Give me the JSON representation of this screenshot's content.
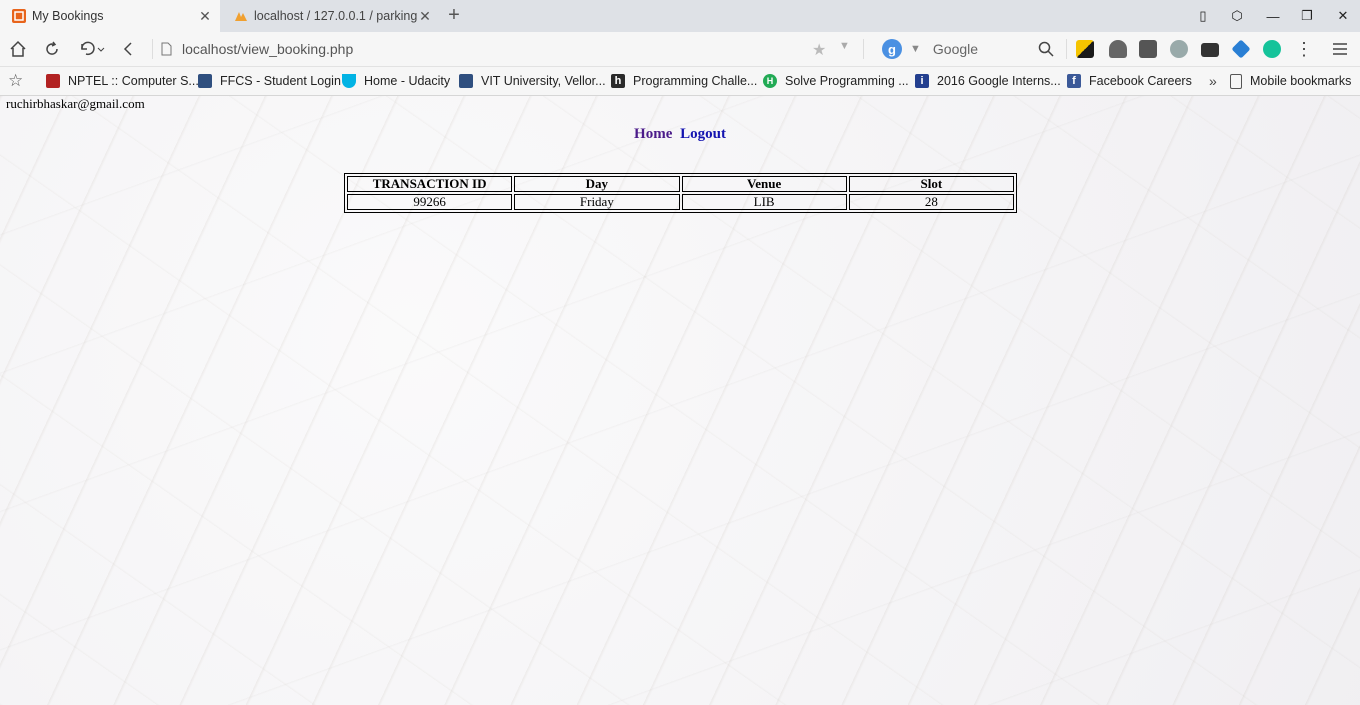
{
  "browser": {
    "tabs": [
      {
        "title": "My Bookings",
        "active": true,
        "favicon": "page-icon"
      },
      {
        "title": "localhost / 127.0.0.1 / parking",
        "active": false,
        "favicon": "phpmyadmin-icon"
      }
    ],
    "address": {
      "url": "localhost/view_booking.php"
    },
    "search": {
      "engine": "Google"
    },
    "bookmarks": [
      {
        "label": "NPTEL :: Computer S...",
        "icon": "nptel-icon",
        "color": "#b22222"
      },
      {
        "label": "FFCS - Student Login",
        "icon": "vit-icon",
        "color": "#2f4f7f"
      },
      {
        "label": "Home - Udacity",
        "icon": "udacity-icon",
        "color": "#02b3e4"
      },
      {
        "label": "VIT University, Vellor...",
        "icon": "vit-icon",
        "color": "#2f4f7f"
      },
      {
        "label": "Programming Challe...",
        "icon": "hackerrank-icon",
        "color": "#2a2a2a"
      },
      {
        "label": "Solve Programming ...",
        "icon": "hackerearth-icon",
        "color": "#22aa55"
      },
      {
        "label": "2016 Google Interns...",
        "icon": "info-icon",
        "color": "#233f8f"
      },
      {
        "label": "Facebook Careers",
        "icon": "facebook-icon",
        "color": "#3b5998"
      }
    ],
    "more_bookmarks": "»",
    "mobile_bookmarks": "Mobile bookmarks"
  },
  "page": {
    "user_email": "ruchirbhaskar@gmail.com",
    "nav": {
      "home": "Home",
      "logout": "Logout"
    },
    "table": {
      "headers": [
        "TRANSACTION ID",
        "Day",
        "Venue",
        "Slot"
      ],
      "rows": [
        [
          "99266",
          "Friday",
          "LIB",
          "28"
        ]
      ]
    }
  }
}
